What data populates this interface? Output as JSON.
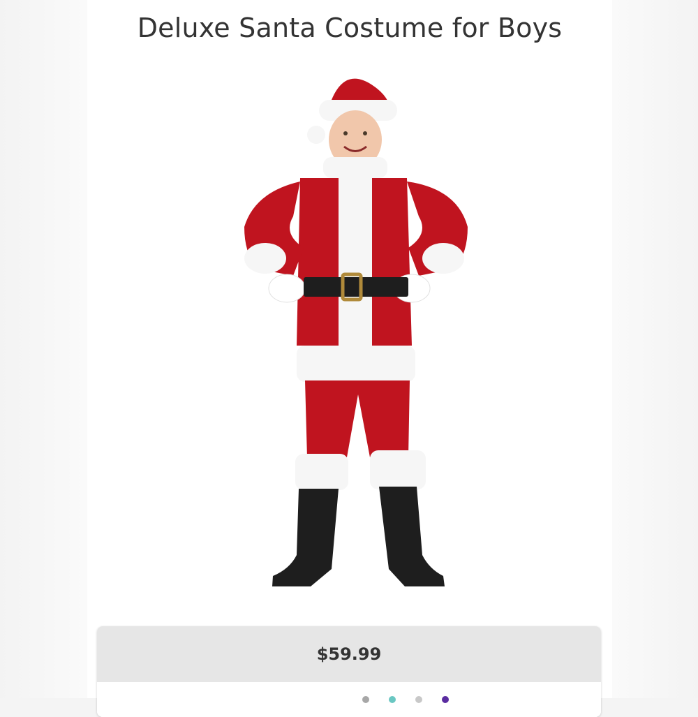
{
  "product": {
    "title": "Deluxe Santa Costume for Boys",
    "price": "$59.99",
    "image_subject": "boy-in-santa-costume"
  },
  "colors": {
    "suit_red": "#c0141f",
    "fur_white": "#f6f6f6",
    "belt_black": "#1e1e1e",
    "buckle_gold": "#b08a3a",
    "price_bar": "#e6e6e6",
    "text": "#333333"
  },
  "indicator_dots": [
    {
      "color": "#a7a7a7"
    },
    {
      "color": "#6ac7c2"
    },
    {
      "color": "#c8c8c8"
    },
    {
      "color": "#5a2ca0"
    }
  ]
}
